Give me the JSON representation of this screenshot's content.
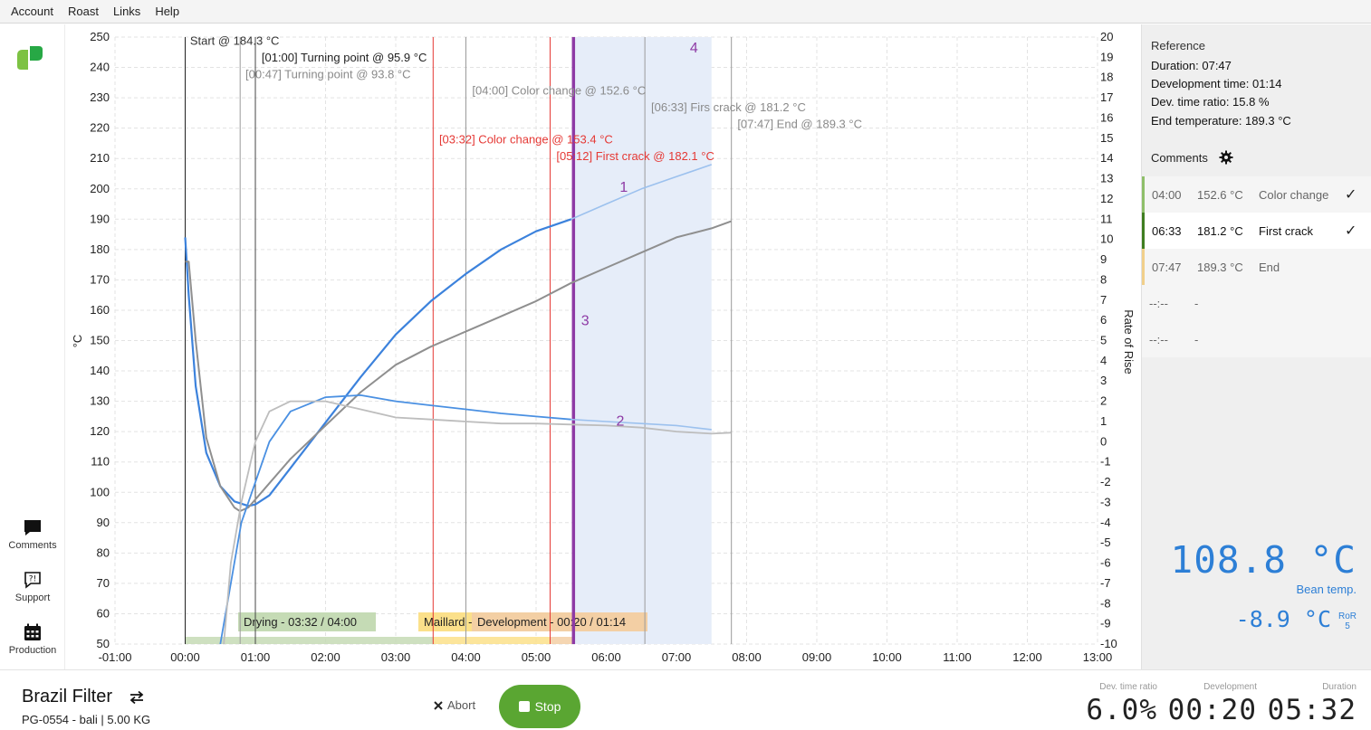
{
  "menu": [
    "Account",
    "Roast",
    "Links",
    "Help"
  ],
  "sidebar": {
    "comments_label": "Comments",
    "support_label": "Support",
    "production_label": "Production"
  },
  "chart_data": {
    "type": "line",
    "x_ticks": [
      "-01:00",
      "00:00",
      "01:00",
      "02:00",
      "03:00",
      "04:00",
      "05:00",
      "06:00",
      "07:00",
      "08:00",
      "09:00",
      "10:00",
      "11:00",
      "12:00",
      "13:00"
    ],
    "y_left_label": "°C",
    "y_left_range": [
      50,
      250
    ],
    "y_left_ticks": [
      50,
      60,
      70,
      80,
      90,
      100,
      110,
      120,
      130,
      140,
      150,
      160,
      170,
      180,
      190,
      200,
      210,
      220,
      230,
      240,
      250
    ],
    "y_right_label": "Rate of Rise",
    "y_right_range": [
      -10,
      20
    ],
    "y_right_ticks": [
      -10,
      -9,
      -8,
      -7,
      -6,
      -5,
      -4,
      -3,
      -2,
      -1,
      0,
      1,
      2,
      3,
      4,
      5,
      6,
      7,
      8,
      9,
      10,
      11,
      12,
      13,
      14,
      15,
      16,
      17,
      18,
      19,
      20
    ],
    "grid": true,
    "colors": {
      "current_bt": "#3c82dc",
      "reference_bt": "#8f8f8f",
      "current_ror": "#4a90e2",
      "reference_ror": "#bdbdbd",
      "current_event": "#e53935",
      "reference_event": "#8a8a8a",
      "now_line": "#8e3aa5",
      "projection_band": "#e6edf9",
      "drying": "#c5dbb5",
      "maillard": "#fbe08a",
      "development": "#f3cfa4"
    },
    "series": [
      {
        "key": "current_bt",
        "x": [
          0,
          0.05,
          0.15,
          0.3,
          0.5,
          0.7,
          0.9,
          1.0,
          1.2,
          1.5,
          2,
          2.5,
          3,
          3.5,
          4,
          4.5,
          5,
          5.5
        ],
        "y": [
          184,
          165,
          135,
          113,
          102,
          97,
          95.5,
          96,
          99,
          108,
          123,
          138,
          152,
          163,
          172,
          180,
          186,
          190
        ]
      },
      {
        "key": "current_bt_projection",
        "x": [
          5.5,
          6,
          6.5,
          7,
          7.5
        ],
        "y": [
          190,
          195,
          200,
          204,
          208
        ]
      },
      {
        "key": "reference_bt",
        "x": [
          0,
          0.05,
          0.15,
          0.3,
          0.5,
          0.7,
          0.78,
          0.9,
          1.2,
          1.5,
          2,
          2.5,
          3,
          3.5,
          4,
          4.5,
          5,
          5.5,
          6,
          6.5,
          7,
          7.5,
          7.78
        ],
        "y": [
          176,
          176,
          150,
          118,
          102,
          95,
          93.8,
          95,
          103,
          111,
          122,
          133,
          142,
          148,
          153,
          158,
          163,
          169,
          174,
          179,
          184,
          187,
          189.3
        ]
      },
      {
        "key": "current_ror",
        "x": [
          0.5,
          0.65,
          0.8,
          1.0,
          1.2,
          1.5,
          2,
          2.5,
          3,
          3.5,
          4,
          4.5,
          5,
          5.5
        ],
        "y": [
          -10,
          -7,
          -4,
          -2,
          0,
          1.5,
          2.2,
          2.3,
          2,
          1.8,
          1.6,
          1.4,
          1.25,
          1.1
        ]
      },
      {
        "key": "current_ror_projection",
        "x": [
          5.5,
          6,
          6.5,
          7,
          7.5
        ],
        "y": [
          1.1,
          1,
          0.9,
          0.8,
          0.6
        ]
      },
      {
        "key": "reference_ror",
        "x": [
          0.55,
          0.65,
          0.8,
          1.0,
          1.2,
          1.5,
          2,
          2.5,
          3,
          3.5,
          4,
          4.5,
          5,
          5.5,
          6,
          6.5,
          7,
          7.5,
          7.78
        ],
        "y": [
          -10,
          -6,
          -3,
          0,
          1.5,
          2,
          2,
          1.6,
          1.2,
          1.1,
          1,
          0.9,
          0.9,
          0.85,
          0.8,
          0.7,
          0.5,
          0.4,
          0.45
        ]
      }
    ],
    "vertical_lines": [
      {
        "t": 0,
        "kind": "start"
      },
      {
        "t": 0.783,
        "kind": "reference"
      },
      {
        "t": 1.0,
        "kind": "current_dark"
      },
      {
        "t": 3.533,
        "kind": "current"
      },
      {
        "t": 4.0,
        "kind": "reference"
      },
      {
        "t": 5.2,
        "kind": "current"
      },
      {
        "t": 5.533,
        "kind": "now"
      },
      {
        "t": 6.55,
        "kind": "reference"
      },
      {
        "t": 7.783,
        "kind": "reference"
      }
    ],
    "projection_band": [
      5.533,
      7.5
    ],
    "annotations": [
      {
        "text": "Start @ 184.3 °C",
        "t": 0.03,
        "temp": 247.5,
        "kind": "start"
      },
      {
        "text": "[01:00] Turning point @ 95.9 °C",
        "t": 1.05,
        "temp": 242,
        "kind": "current_dark"
      },
      {
        "text": "[00:47] Turning point @ 93.8 °C",
        "t": 0.82,
        "temp": 236.5,
        "kind": "reference"
      },
      {
        "text": "[04:00] Color change @ 152.6 °C",
        "t": 4.05,
        "temp": 231,
        "kind": "reference"
      },
      {
        "text": "[06:33] Firs crack @ 181.2 °C",
        "t": 6.6,
        "temp": 225.5,
        "kind": "reference"
      },
      {
        "text": "[07:47] End @ 189.3 °C",
        "t": 7.83,
        "temp": 220,
        "kind": "reference"
      },
      {
        "text": "[03:32] Color change @ 153.4 °C",
        "t": 3.58,
        "temp": 215,
        "kind": "current"
      },
      {
        "text": "[05:12] First crack @ 182.1 °C",
        "t": 5.25,
        "temp": 209.5,
        "kind": "current"
      }
    ],
    "markers": [
      {
        "label": "1",
        "t": 6.25,
        "temp": 199
      },
      {
        "label": "2",
        "t": 6.2,
        "temp": 122
      },
      {
        "label": "3",
        "t": 5.7,
        "temp": 155
      },
      {
        "label": "4",
        "t": 7.25,
        "temp": 245
      }
    ],
    "phases": [
      {
        "label": "Drying - 03:32 / 04:00",
        "kind": "drying"
      },
      {
        "label": "Maillard - ",
        "kind": "maillard"
      },
      {
        "label": "Development - 00:20 / 01:14",
        "kind": "development"
      }
    ],
    "phase_bar": [
      {
        "from": 0,
        "to": 3.533,
        "kind": "drying"
      },
      {
        "from": 3.533,
        "to": 5.2,
        "kind": "maillard"
      },
      {
        "from": 5.2,
        "to": 5.533,
        "kind": "development"
      }
    ]
  },
  "reference": {
    "title": "Reference",
    "duration": "Duration: 07:47",
    "development": "Development time: 01:14",
    "dev_ratio": "Dev. time ratio: 15.8 %",
    "end_temp": "End temperature: 189.3 °C"
  },
  "comments": {
    "header": "Comments",
    "rows": [
      {
        "time": "04:00",
        "temp": "152.6 °C",
        "label": "Color change",
        "check": "✓",
        "color": "#8fbf6a",
        "bg": "#f5f5f5",
        "muted": true
      },
      {
        "time": "06:33",
        "temp": "181.2 °C",
        "label": "First crack",
        "check": "✓",
        "color": "#3f7d20",
        "bg": "#ffffff",
        "muted": false
      },
      {
        "time": "07:47",
        "temp": "189.3 °C",
        "label": "End",
        "check": "",
        "color": "#f1cf8a",
        "bg": "#f5f5f5",
        "muted": true
      },
      {
        "time": "--:--",
        "temp": "-",
        "label": "",
        "check": "",
        "color": "",
        "bg": "#f5f5f5",
        "muted": true
      },
      {
        "time": "--:--",
        "temp": "-",
        "label": "",
        "check": "",
        "color": "",
        "bg": "#f5f5f5",
        "muted": true
      }
    ]
  },
  "live": {
    "bean_temp": "108.8 °C",
    "bean_temp_label": "Bean temp.",
    "ror": "-8.9 °C",
    "ror_label": "RoR",
    "ror_window": "5"
  },
  "profile": {
    "name": "Brazil Filter",
    "details": "PG-0554 - bali  | 5.00 KG"
  },
  "controls": {
    "abort": "Abort",
    "stop": "Stop"
  },
  "stats": {
    "dev_ratio_label": "Dev. time ratio",
    "dev_ratio": "6.0%",
    "development_label": "Development",
    "development": "00:20",
    "duration_label": "Duration",
    "duration": "05:32"
  }
}
